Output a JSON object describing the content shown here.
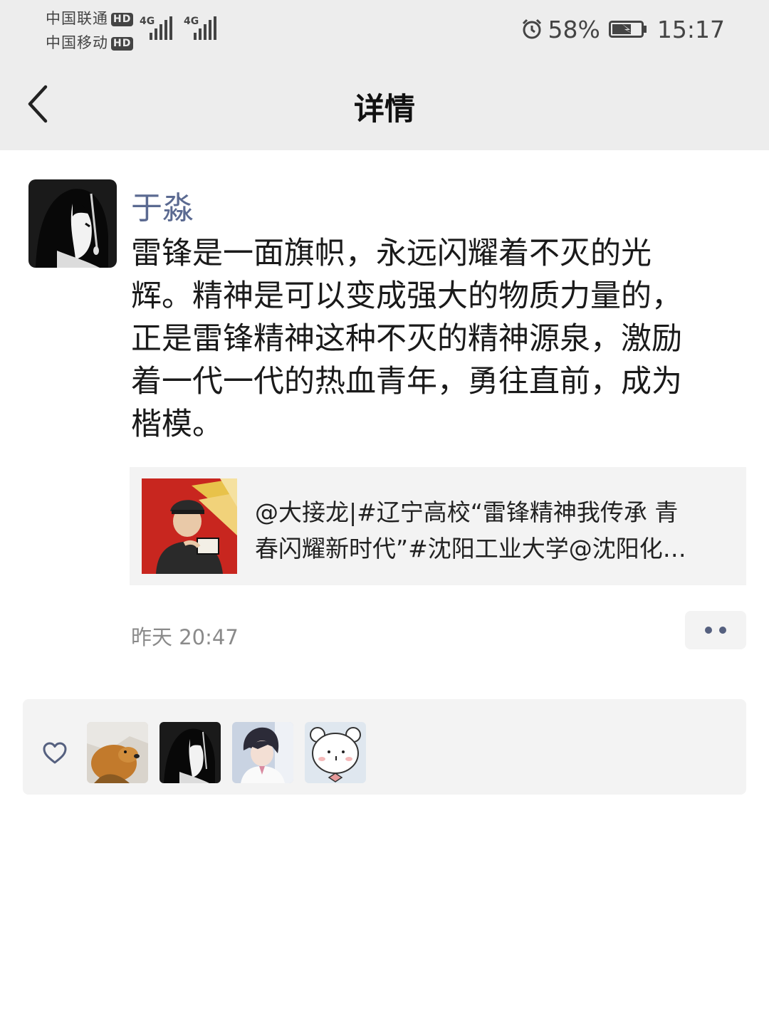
{
  "status_bar": {
    "carrier1": "中国联通",
    "carrier2": "中国移动",
    "hd_badge": "HD",
    "network1": "4G",
    "network2": "4G",
    "battery": "58%",
    "time": "15:17"
  },
  "header": {
    "title": "详情"
  },
  "post": {
    "author": "于淼",
    "text_lines": [
      "雷锋是一面旗帜，永远闪耀着不灭的光",
      "辉。精神是可以变成强大的物质力量的，",
      "正是雷锋精神这种不灭的精神源泉，激励",
      "着一代一代的热血青年，勇往直前，成为",
      "楷模。"
    ],
    "link_lines": [
      "@大接龙|#辽宁高校“雷锋精神我传承 青",
      "春闪耀新时代”#沈阳工业大学@沈阳化…"
    ],
    "timestamp": "昨天 20:47"
  },
  "likes": {
    "avatars": [
      "dog-avatar",
      "anime-girl-avatar",
      "anime-boy-avatar",
      "cartoon-bear-avatar"
    ]
  },
  "colors": {
    "username": "#5b6a91",
    "topbar_bg": "#ededed",
    "card_bg": "#f3f3f3"
  }
}
